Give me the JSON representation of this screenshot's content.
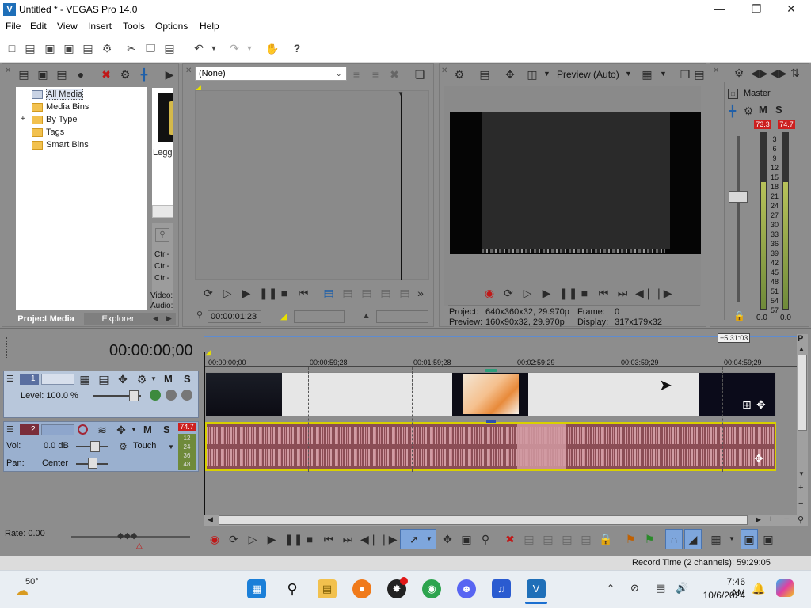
{
  "window": {
    "app_icon_letter": "V",
    "title": "Untitled * - VEGAS Pro 14.0",
    "minimize_icon": "minimize-icon",
    "maximize_icon": "maximize-icon",
    "close_icon": "close-icon"
  },
  "menu": [
    "File",
    "Edit",
    "View",
    "Insert",
    "Tools",
    "Options",
    "Help"
  ],
  "project_media": {
    "tree": [
      {
        "label": "All Media",
        "selected": true
      },
      {
        "label": "Media Bins"
      },
      {
        "label": "By Type",
        "expand": "+"
      },
      {
        "label": "Tags"
      },
      {
        "label": "Smart Bins"
      }
    ],
    "thumb_label": "Leggo",
    "ctrl_labels": [
      "Ctrl-",
      "Ctrl-",
      "Ctrl-"
    ],
    "side_labels": [
      "Video:",
      "Audio:"
    ],
    "tabs": {
      "project_media": "Project Media",
      "explorer": "Explorer"
    }
  },
  "trimmer": {
    "select_value": "(None)",
    "timecode": "00:00:01;23"
  },
  "preview": {
    "mode_label": "Preview (Auto)",
    "project_label": "Project:",
    "project_value": "640x360x32, 29.970p",
    "preview_label": "Preview:",
    "preview_value": "160x90x32, 29.970p",
    "frame_label": "Frame:",
    "frame_value": "0",
    "display_label": "Display:",
    "display_value": "317x179x32"
  },
  "mixer": {
    "master_label": "Master",
    "m_label": "M",
    "s_label": "S",
    "peak_left": "73.3",
    "peak_right": "74.7",
    "scale": [
      "3",
      "6",
      "9",
      "12",
      "15",
      "18",
      "21",
      "24",
      "27",
      "30",
      "33",
      "36",
      "39",
      "42",
      "45",
      "48",
      "51",
      "54",
      "57"
    ],
    "level_left": "0.0",
    "level_right": "0.0"
  },
  "timeline": {
    "timecode": "00:00:00;00",
    "end_marker": "+5:31:03",
    "ruler": [
      "00:00:00;00",
      "00:00:59;28",
      "00:01:59;28",
      "00:02:59;29",
      "00:03:59;29",
      "00:04:59;29"
    ],
    "video_track": {
      "number": "1",
      "level_label": "Level: 100.0 %",
      "m_label": "M",
      "s_label": "S"
    },
    "audio_track": {
      "number": "2",
      "peak": "74.7",
      "vol_label": "Vol:",
      "vol_value": "0.0 dB",
      "pan_label": "Pan:",
      "pan_value": "Center",
      "touch_label": "Touch",
      "m_label": "M",
      "s_label": "S",
      "meter_scale": [
        "12",
        "24",
        "36",
        "48"
      ]
    },
    "rate_label": "Rate: 0.00"
  },
  "status": {
    "record_time": "Record Time (2 channels): 59:29:05"
  },
  "taskbar": {
    "weather": "50°",
    "time": "7:46 AM",
    "date": "10/6/2024"
  },
  "colors": {
    "panel_gray": "#8d8d8d",
    "video_clip_light": "#e6e6e6",
    "audio_clip": "#8b4d55",
    "audio_wave": "#d9a5ac",
    "track_header": "#b8c7db",
    "track_header_selected": "#9ab0cf",
    "peak_red": "#cc1f1f",
    "selection_yellow": "#e8e000"
  }
}
